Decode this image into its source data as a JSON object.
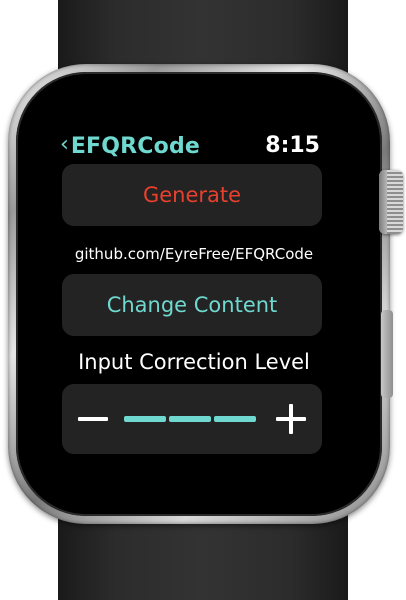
{
  "app": {
    "back_chevron": "‹",
    "title": "EFQRCode",
    "time": "8:15"
  },
  "buttons": {
    "generate_label": "Generate",
    "change_content_label": "Change Content"
  },
  "content": {
    "value": "github.com/EyreFree/EFQRCode"
  },
  "correction": {
    "label": "Input Correction Level",
    "level": 3,
    "max_level": 3,
    "minus_icon": "minus-icon",
    "plus_icon": "plus-icon"
  },
  "colors": {
    "accent": "#6fd8cf",
    "generate": "#e8402c",
    "button_bg": "#232323",
    "track_inactive": "#3a3a3a"
  }
}
